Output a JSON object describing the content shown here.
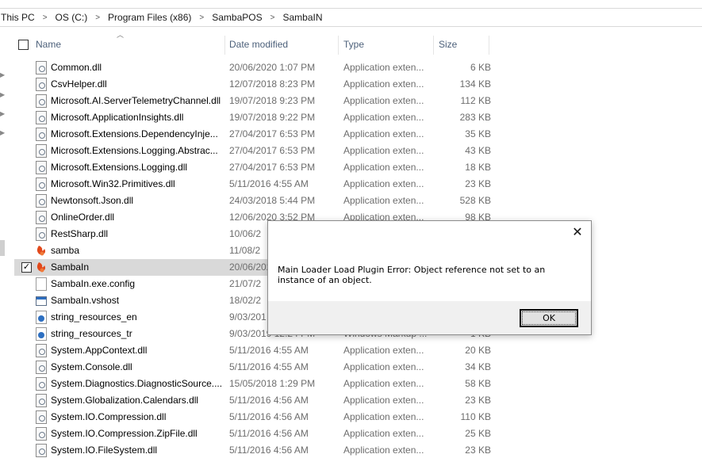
{
  "breadcrumb": [
    "This PC",
    "OS (C:)",
    "Program Files (x86)",
    "SambaPOS",
    "SambaIN"
  ],
  "columns": {
    "name": "Name",
    "date": "Date modified",
    "type": "Type",
    "size": "Size"
  },
  "files": [
    {
      "name": "Common.dll",
      "date": "20/06/2020 1:07 PM",
      "type": "Application exten...",
      "size": "6 KB",
      "icon": "dll-icon"
    },
    {
      "name": "CsvHelper.dll",
      "date": "12/07/2018 8:23 PM",
      "type": "Application exten...",
      "size": "134 KB",
      "icon": "dll-icon"
    },
    {
      "name": "Microsoft.AI.ServerTelemetryChannel.dll",
      "date": "19/07/2018 9:23 PM",
      "type": "Application exten...",
      "size": "112 KB",
      "icon": "dll-icon"
    },
    {
      "name": "Microsoft.ApplicationInsights.dll",
      "date": "19/07/2018 9:22 PM",
      "type": "Application exten...",
      "size": "283 KB",
      "icon": "dll-icon"
    },
    {
      "name": "Microsoft.Extensions.DependencyInje...",
      "date": "27/04/2017 6:53 PM",
      "type": "Application exten...",
      "size": "35 KB",
      "icon": "dll-icon"
    },
    {
      "name": "Microsoft.Extensions.Logging.Abstrac...",
      "date": "27/04/2017 6:53 PM",
      "type": "Application exten...",
      "size": "43 KB",
      "icon": "dll-icon"
    },
    {
      "name": "Microsoft.Extensions.Logging.dll",
      "date": "27/04/2017 6:53 PM",
      "type": "Application exten...",
      "size": "18 KB",
      "icon": "dll-icon"
    },
    {
      "name": "Microsoft.Win32.Primitives.dll",
      "date": "5/11/2016 4:55 AM",
      "type": "Application exten...",
      "size": "23 KB",
      "icon": "dll-icon"
    },
    {
      "name": "Newtonsoft.Json.dll",
      "date": "24/03/2018 5:44 PM",
      "type": "Application exten...",
      "size": "528 KB",
      "icon": "dll-icon"
    },
    {
      "name": "OnlineOrder.dll",
      "date": "12/06/2020 3:52 PM",
      "type": "Application exten...",
      "size": "98 KB",
      "icon": "dll-icon"
    },
    {
      "name": "RestSharp.dll",
      "date": "10/06/2",
      "type": "",
      "size": "",
      "icon": "dll-icon"
    },
    {
      "name": "samba",
      "date": "11/08/2",
      "type": "",
      "size": "",
      "icon": "samba-icon"
    },
    {
      "name": "SambaIn",
      "date": "20/06/202",
      "type": "",
      "size": "",
      "icon": "samba-icon",
      "selected": true
    },
    {
      "name": "SambaIn.exe.config",
      "date": "21/07/2",
      "type": "",
      "size": "",
      "icon": "file-icon"
    },
    {
      "name": "SambaIn.vshost",
      "date": "18/02/2",
      "type": "",
      "size": "",
      "icon": "app-icon"
    },
    {
      "name": "string_resources_en",
      "date": "9/03/201",
      "type": "",
      "size": "",
      "icon": "xml-icon"
    },
    {
      "name": "string_resources_tr",
      "date": "9/03/2019 12:24 PM",
      "type": "Windows Markup ...",
      "size": "1 KB",
      "icon": "xml-icon"
    },
    {
      "name": "System.AppContext.dll",
      "date": "5/11/2016 4:55 AM",
      "type": "Application exten...",
      "size": "20 KB",
      "icon": "dll-icon"
    },
    {
      "name": "System.Console.dll",
      "date": "5/11/2016 4:55 AM",
      "type": "Application exten...",
      "size": "34 KB",
      "icon": "dll-icon"
    },
    {
      "name": "System.Diagnostics.DiagnosticSource....",
      "date": "15/05/2018 1:29 PM",
      "type": "Application exten...",
      "size": "58 KB",
      "icon": "dll-icon"
    },
    {
      "name": "System.Globalization.Calendars.dll",
      "date": "5/11/2016 4:56 AM",
      "type": "Application exten...",
      "size": "23 KB",
      "icon": "dll-icon"
    },
    {
      "name": "System.IO.Compression.dll",
      "date": "5/11/2016 4:56 AM",
      "type": "Application exten...",
      "size": "110 KB",
      "icon": "dll-icon"
    },
    {
      "name": "System.IO.Compression.ZipFile.dll",
      "date": "5/11/2016 4:56 AM",
      "type": "Application exten...",
      "size": "25 KB",
      "icon": "dll-icon"
    },
    {
      "name": "System.IO.FileSystem.dll",
      "date": "5/11/2016 4:56 AM",
      "type": "Application exten...",
      "size": "23 KB",
      "icon": "dll-icon"
    }
  ],
  "dialog": {
    "message": "Main Loader Load Plugin Error: Object reference not set to an instance of an object.",
    "ok_label": "OK",
    "close_glyph": "✕"
  }
}
